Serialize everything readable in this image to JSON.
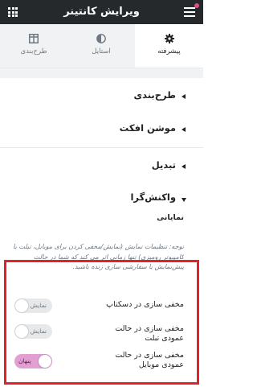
{
  "header": {
    "title": "ویرایش کانتینر",
    "menu_icon": "hamburger-icon",
    "apps_icon": "grid-icon"
  },
  "tabs": [
    {
      "label": "طرح‌بندی",
      "icon": "layout-icon",
      "active": false
    },
    {
      "label": "استایل",
      "icon": "contrast-icon",
      "active": false
    },
    {
      "label": "پیشرفته",
      "icon": "gear-icon",
      "active": true
    }
  ],
  "sections": [
    {
      "label": "طرح‌بندی",
      "expanded": false
    },
    {
      "label": "موشن افکت",
      "expanded": false
    },
    {
      "label": "تبدیل",
      "expanded": false
    },
    {
      "label": "واکنش‌گرا",
      "expanded": true
    }
  ],
  "responsive": {
    "subheading": "نمایانی",
    "note": "توجه: تنظیمات نمایش (نمایش/مخفی کردن برای موبایل، تبلت یا کامپیوتر رومیزی) تنها زمانی اثر می کند که شما در حالت پیش‌نمایش یا سفارشی سازی زنده باشید.",
    "controls": [
      {
        "label": "مخفی سازی در دسکتاپ",
        "state_label": "نمایش",
        "on": false
      },
      {
        "label": "مخفی سازی در حالت عمودی تبلت",
        "state_label": "نمایش",
        "on": false
      },
      {
        "label": "مخفی سازی در حالت عمودی موبایل",
        "state_label": "پنهان",
        "on": true
      }
    ]
  },
  "colors": {
    "topbar": "#26292c",
    "highlight": "#e32126",
    "toggle_on": "#e2a0d2",
    "accent_dot": "#e04e8d"
  }
}
